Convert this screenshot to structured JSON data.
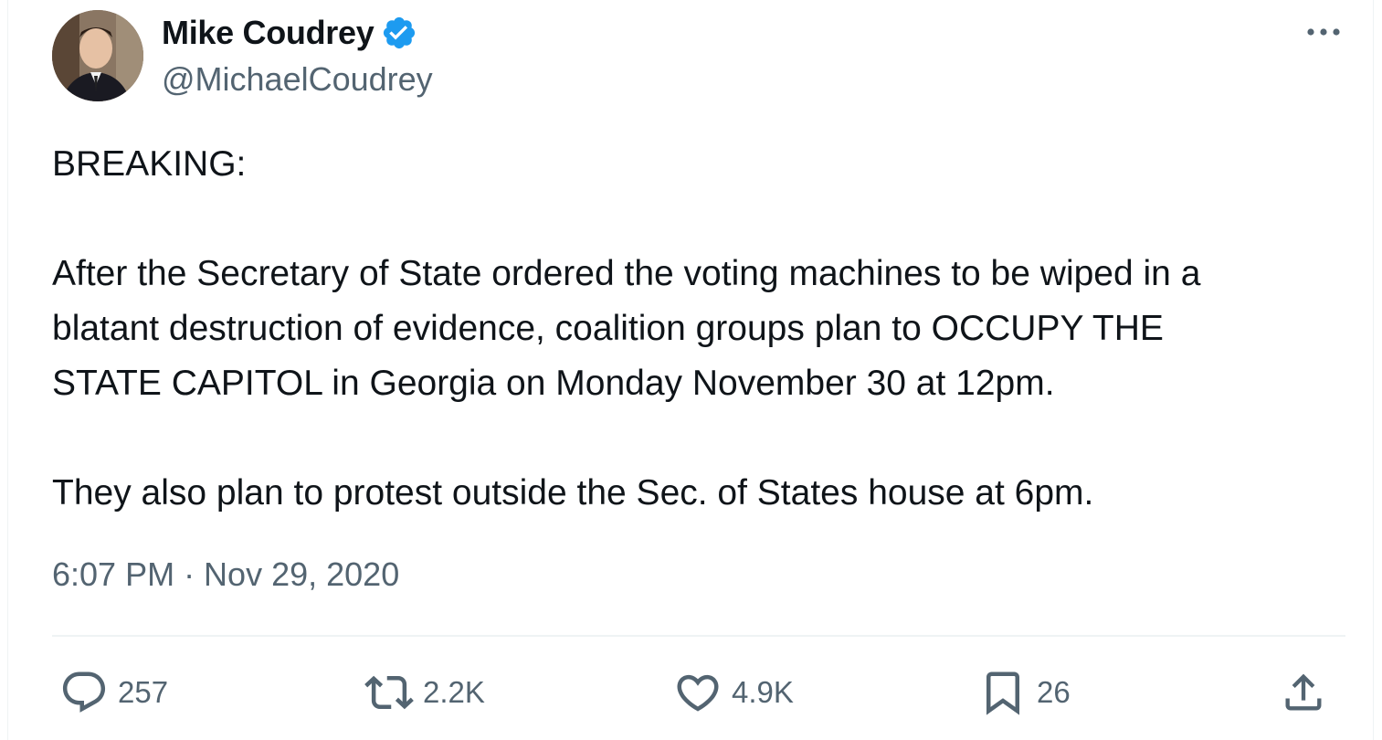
{
  "author": {
    "display_name": "Mike Coudrey",
    "handle": "@MichaelCoudrey",
    "verified": true,
    "verified_color": "#1d9bf0"
  },
  "tweet": {
    "lines": [
      "BREAKING:",
      "",
      "After the Secretary of State ordered the voting machines to be wiped in a",
      "blatant destruction of evidence, coalition groups plan to OCCUPY THE",
      "STATE CAPITOL in Georgia on Monday November 30 at 12pm.",
      "",
      "They also plan to protest outside the Sec. of States house at 6pm."
    ],
    "timestamp": "6:07 PM · Nov 29, 2020"
  },
  "actions": {
    "reply_count": "257",
    "retweet_count": "2.2K",
    "like_count": "4.9K",
    "bookmark_count": "26"
  },
  "icons": {
    "more": "more-horizontal-icon",
    "reply": "reply-bubble-icon",
    "retweet": "retweet-icon",
    "like": "heart-icon",
    "bookmark": "bookmark-icon",
    "share": "share-upload-icon"
  },
  "colors": {
    "text": "#0f1419",
    "secondary": "#536471",
    "divider": "#eff3f4"
  }
}
